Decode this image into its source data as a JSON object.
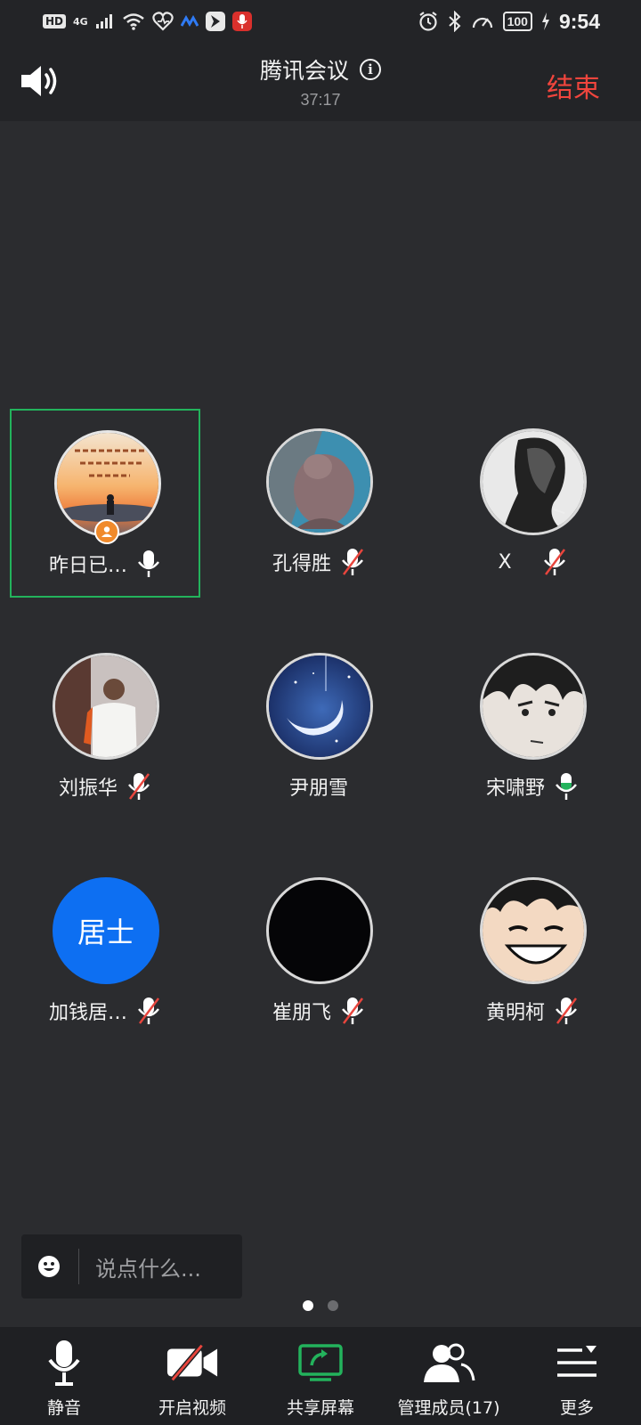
{
  "status_bar": {
    "hd": "HD",
    "network": "4G",
    "battery": "100",
    "time": "9:54",
    "icons": [
      "signal-icon",
      "wifi-icon",
      "heart-icon",
      "app-icon",
      "app-icon",
      "mic-recording-icon",
      "alarm-icon",
      "bluetooth-icon",
      "speedometer-icon",
      "charging-icon"
    ]
  },
  "header": {
    "title": "腾讯会议",
    "timer": "37:17",
    "end_label": "结束"
  },
  "participants": [
    {
      "name": "昨日已…",
      "mic": "on",
      "host": true,
      "active": true,
      "avatar": "sunset-image"
    },
    {
      "name": "孔得胜",
      "mic": "muted",
      "avatar": "animal-image"
    },
    {
      "name": "X",
      "mic": "muted",
      "avatar": "portrait-bw-image"
    },
    {
      "name": "刘振华",
      "mic": "muted",
      "avatar": "photo-image"
    },
    {
      "name": "尹朋雪",
      "mic": "none",
      "avatar": "moon-image"
    },
    {
      "name": "宋啸野",
      "mic": "speaking",
      "avatar": "anime-image"
    },
    {
      "name": "加钱居…",
      "mic": "muted",
      "avatar_text": "居士"
    },
    {
      "name": "崔朋飞",
      "mic": "muted",
      "avatar": "black-image"
    },
    {
      "name": "黄明柯",
      "mic": "muted",
      "avatar": "anime-luffy-image"
    }
  ],
  "chat": {
    "placeholder": "说点什么..."
  },
  "pagination": {
    "current": 1,
    "total": 2
  },
  "toolbar": {
    "mute_label": "静音",
    "video_label": "开启视频",
    "share_label": "共享屏幕",
    "members_label": "管理成员(17)",
    "more_label": "更多"
  },
  "colors": {
    "end": "#f0453d",
    "active_border": "#23b35c",
    "host_badge": "#f08a2b",
    "text_avatar": "#0d6ff2",
    "share_icon": "#23b35c"
  }
}
